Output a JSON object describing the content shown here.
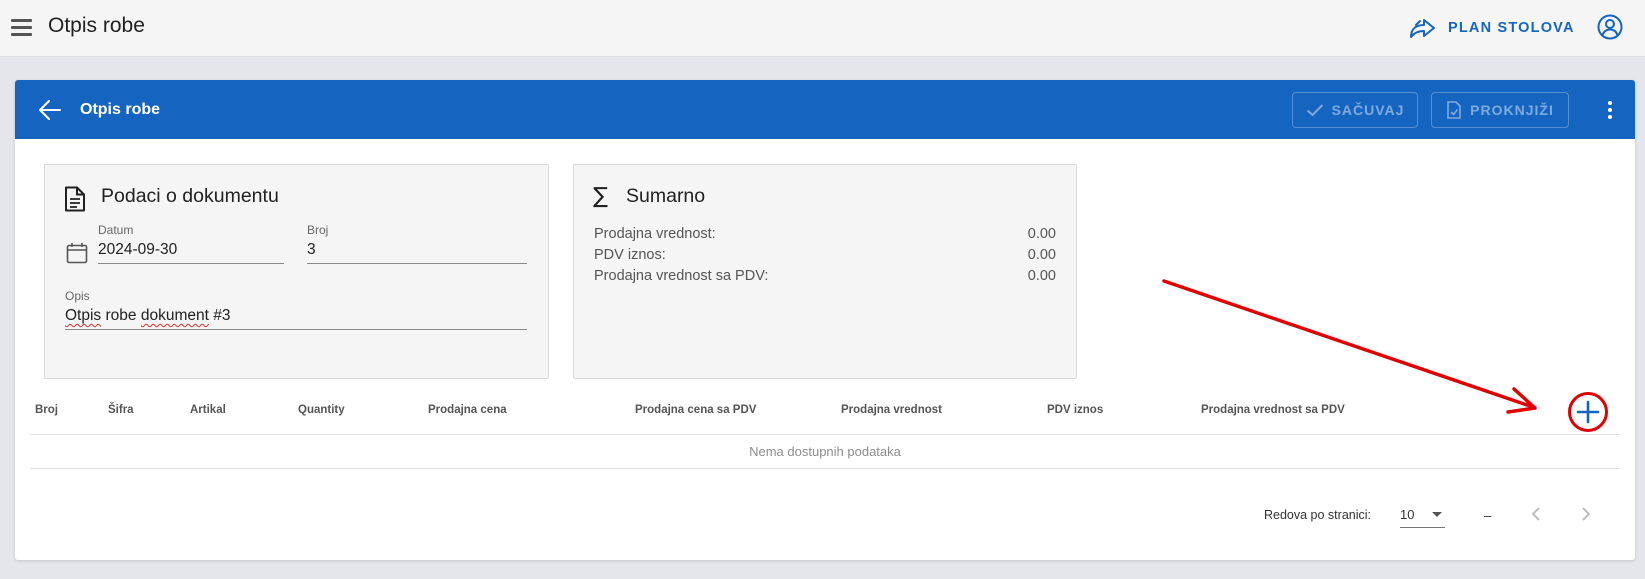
{
  "topbar": {
    "title": "Otpis robe",
    "plan_label": "PLAN STOLOVA"
  },
  "card": {
    "title": "Otpis robe",
    "save_label": "SAČUVAJ",
    "post_label": "PROKNJIŽI"
  },
  "doc_panel": {
    "title": "Podaci o dokumentu",
    "date_label": "Datum",
    "date_value": "2024-09-30",
    "number_label": "Broj",
    "number_value": "3",
    "desc_label": "Opis",
    "desc_word1": "Otpis",
    "desc_word2": "robe",
    "desc_word3": "dokument",
    "desc_word4": "#3"
  },
  "sum_panel": {
    "title": "Sumarno",
    "rows": [
      {
        "label": "Prodajna vrednost:",
        "value": "0.00"
      },
      {
        "label": "PDV iznos:",
        "value": "0.00"
      },
      {
        "label": "Prodajna vrednost sa PDV:",
        "value": "0.00"
      }
    ]
  },
  "table": {
    "columns": [
      "Broj",
      "Šifra",
      "Artikal",
      "Quantity",
      "Prodajna cena",
      "Prodajna cena sa PDV",
      "Prodajna vrednost",
      "PDV iznos",
      "Prodajna vrednost sa PDV"
    ],
    "empty_text": "Nema dostupnih podataka"
  },
  "pagination": {
    "rows_label": "Redova po stranici:",
    "rows_value": "10",
    "range_text": "–"
  },
  "colors": {
    "primary": "#1565c0",
    "annotation": "#e00000"
  }
}
